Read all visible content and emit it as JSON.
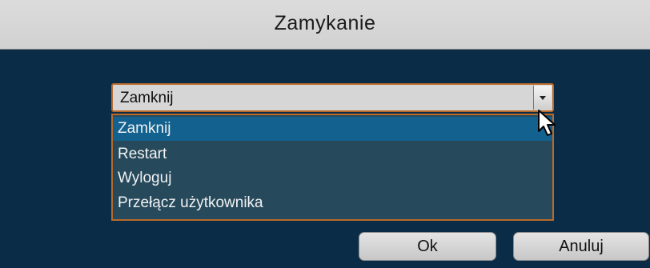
{
  "dialog": {
    "title": "Zamykanie"
  },
  "combo": {
    "selected_value": "Zamknij"
  },
  "dropdown": {
    "options": [
      {
        "label": "Zamknij",
        "selected": true
      },
      {
        "label": "Restart",
        "selected": false
      },
      {
        "label": "Wyloguj",
        "selected": false
      },
      {
        "label": "Przełącz użytkownika",
        "selected": false
      }
    ]
  },
  "buttons": {
    "ok_label": "Ok",
    "cancel_label": "Anuluj"
  },
  "colors": {
    "body_background": "#0b2c46",
    "titlebar_background": "#d1d1d1",
    "selection_highlight": "#12618f",
    "list_background": "#264a5c",
    "focus_border": "#b86a2a"
  }
}
